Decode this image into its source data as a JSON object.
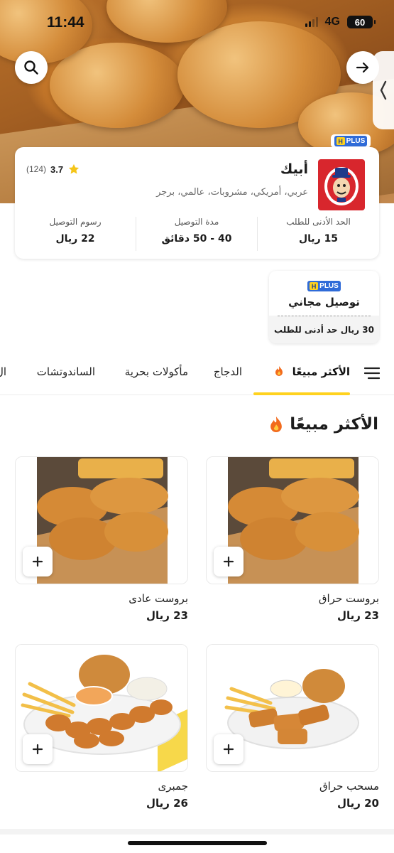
{
  "status_bar": {
    "time": "11:44",
    "network": "4G",
    "battery": "60"
  },
  "restaurant": {
    "name": "أبيك",
    "cuisine": "عربي، أمريكي، مشروبات، عالمي، برجر",
    "rating": "3.7",
    "reviews": "(124)",
    "plus_badge": "PLUS",
    "plus_h": "H",
    "stats": [
      {
        "label": "الحد الأدنى للطلب",
        "value": "15 ريال"
      },
      {
        "label": "مدة التوصيل",
        "value": "40 - 50 دقائق"
      },
      {
        "label": "رسوم التوصيل",
        "value": "22 ريال"
      }
    ]
  },
  "promo": {
    "badge": "PLUS",
    "badge_h": "H",
    "title": "توصيل مجاني",
    "subtitle": "30 ريال حد أدنى للطلب"
  },
  "tabs": [
    {
      "label": "الأكثر مبيعًا",
      "active": true
    },
    {
      "label": "الدجاج"
    },
    {
      "label": "مأكولات بحرية"
    },
    {
      "label": "الساندوتشات"
    },
    {
      "label": "ال"
    }
  ],
  "section": {
    "title": "الأكثر مبيعًا"
  },
  "products": [
    {
      "name": "بروست حراق",
      "price": "23 ريال"
    },
    {
      "name": "بروست عادى",
      "price": "23 ريال"
    },
    {
      "name": "مسحب حراق",
      "price": "20 ريال"
    },
    {
      "name": "جمبرى",
      "price": "26 ريال"
    }
  ],
  "icons": {
    "search": "search-icon",
    "share": "arrow-right-icon",
    "menu": "menu-icon",
    "star": "star-icon",
    "fire": "fire-icon",
    "add": "plus-icon"
  },
  "colors": {
    "accent": "#ffd21e",
    "plus_blue": "#2f6bd8",
    "star": "#f5c518"
  }
}
